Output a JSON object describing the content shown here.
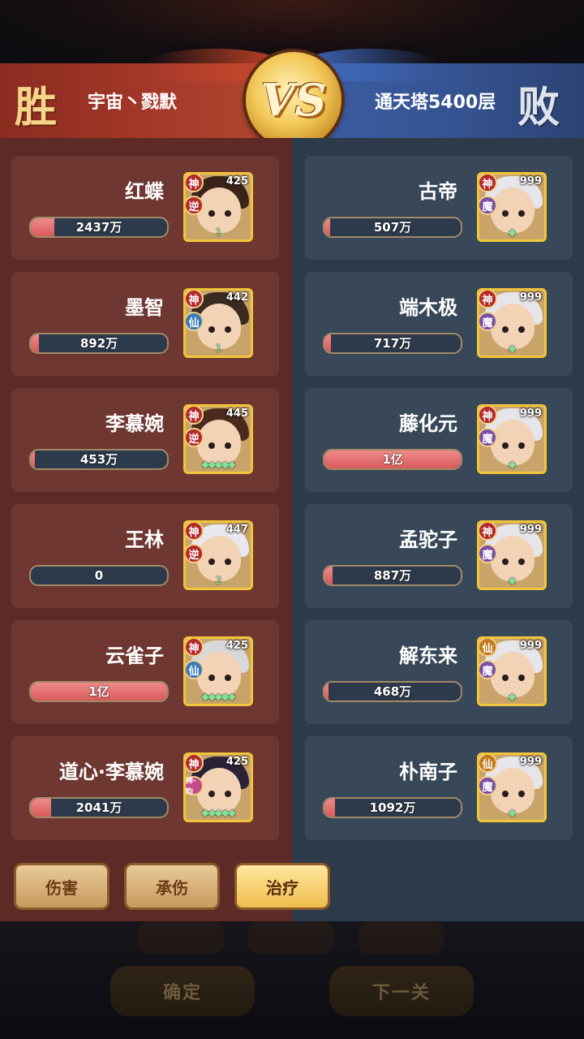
{
  "header": {
    "win_label": "胜",
    "lose_label": "败",
    "left_team": "宇宙丶戮默",
    "right_team": "通天塔5400层",
    "vs_label": "VS"
  },
  "tabs": [
    {
      "label": "伤害",
      "active": false
    },
    {
      "label": "承伤",
      "active": false
    },
    {
      "label": "治疗",
      "active": true
    }
  ],
  "bottom_buttons": {
    "confirm": "确定",
    "next": "下一关"
  },
  "left_heroes": [
    {
      "name": "红蝶",
      "value": "2437万",
      "fill": 0.17,
      "level": "425",
      "badge1": "神",
      "badge2": "逆",
      "stars": "1"
    },
    {
      "name": "墨智",
      "value": "892万",
      "fill": 0.06,
      "level": "442",
      "badge1": "神",
      "badge2": "仙",
      "stars": "1"
    },
    {
      "name": "李慕婉",
      "value": "453万",
      "fill": 0.03,
      "level": "445",
      "badge1": "神",
      "badge2": "逆",
      "stars": "◆◆◆◆◆"
    },
    {
      "name": "王林",
      "value": "0",
      "fill": 0,
      "level": "447",
      "badge1": "神",
      "badge2": "逆",
      "stars": "2"
    },
    {
      "name": "云雀子",
      "value": "1亿",
      "fill": 1.0,
      "level": "425",
      "badge1": "神",
      "badge2": "仙",
      "stars": "◆◆◆◆◆"
    },
    {
      "name": "道心·李慕婉",
      "value": "2041万",
      "fill": 0.15,
      "level": "425",
      "badge1": "神",
      "badge2": "神·昀",
      "stars": "◆◆◆◆◆"
    }
  ],
  "right_heroes": [
    {
      "name": "古帝",
      "value": "507万",
      "fill": 0.04,
      "level": "999",
      "badge1": "神",
      "badge2": "魔",
      "stars": "◆"
    },
    {
      "name": "端木极",
      "value": "717万",
      "fill": 0.05,
      "level": "999",
      "badge1": "神",
      "badge2": "魔",
      "stars": "◆"
    },
    {
      "name": "藤化元",
      "value": "1亿",
      "fill": 1.0,
      "level": "999",
      "badge1": "神",
      "badge2": "魔",
      "stars": "◆"
    },
    {
      "name": "孟驼子",
      "value": "887万",
      "fill": 0.06,
      "level": "999",
      "badge1": "神",
      "badge2": "魔",
      "stars": "◆"
    },
    {
      "name": "解东来",
      "value": "468万",
      "fill": 0.03,
      "level": "999",
      "badge1": "仙",
      "badge2": "魔",
      "stars": "◆"
    },
    {
      "name": "朴南子",
      "value": "1092万",
      "fill": 0.08,
      "level": "999",
      "badge1": "仙",
      "badge2": "魔",
      "stars": "◆"
    }
  ],
  "colors": {
    "left_panel": "#5e2a25",
    "right_panel": "#2c3a49",
    "bar_fill": "#e36a6a",
    "frame_gold": "#f2c53a"
  }
}
